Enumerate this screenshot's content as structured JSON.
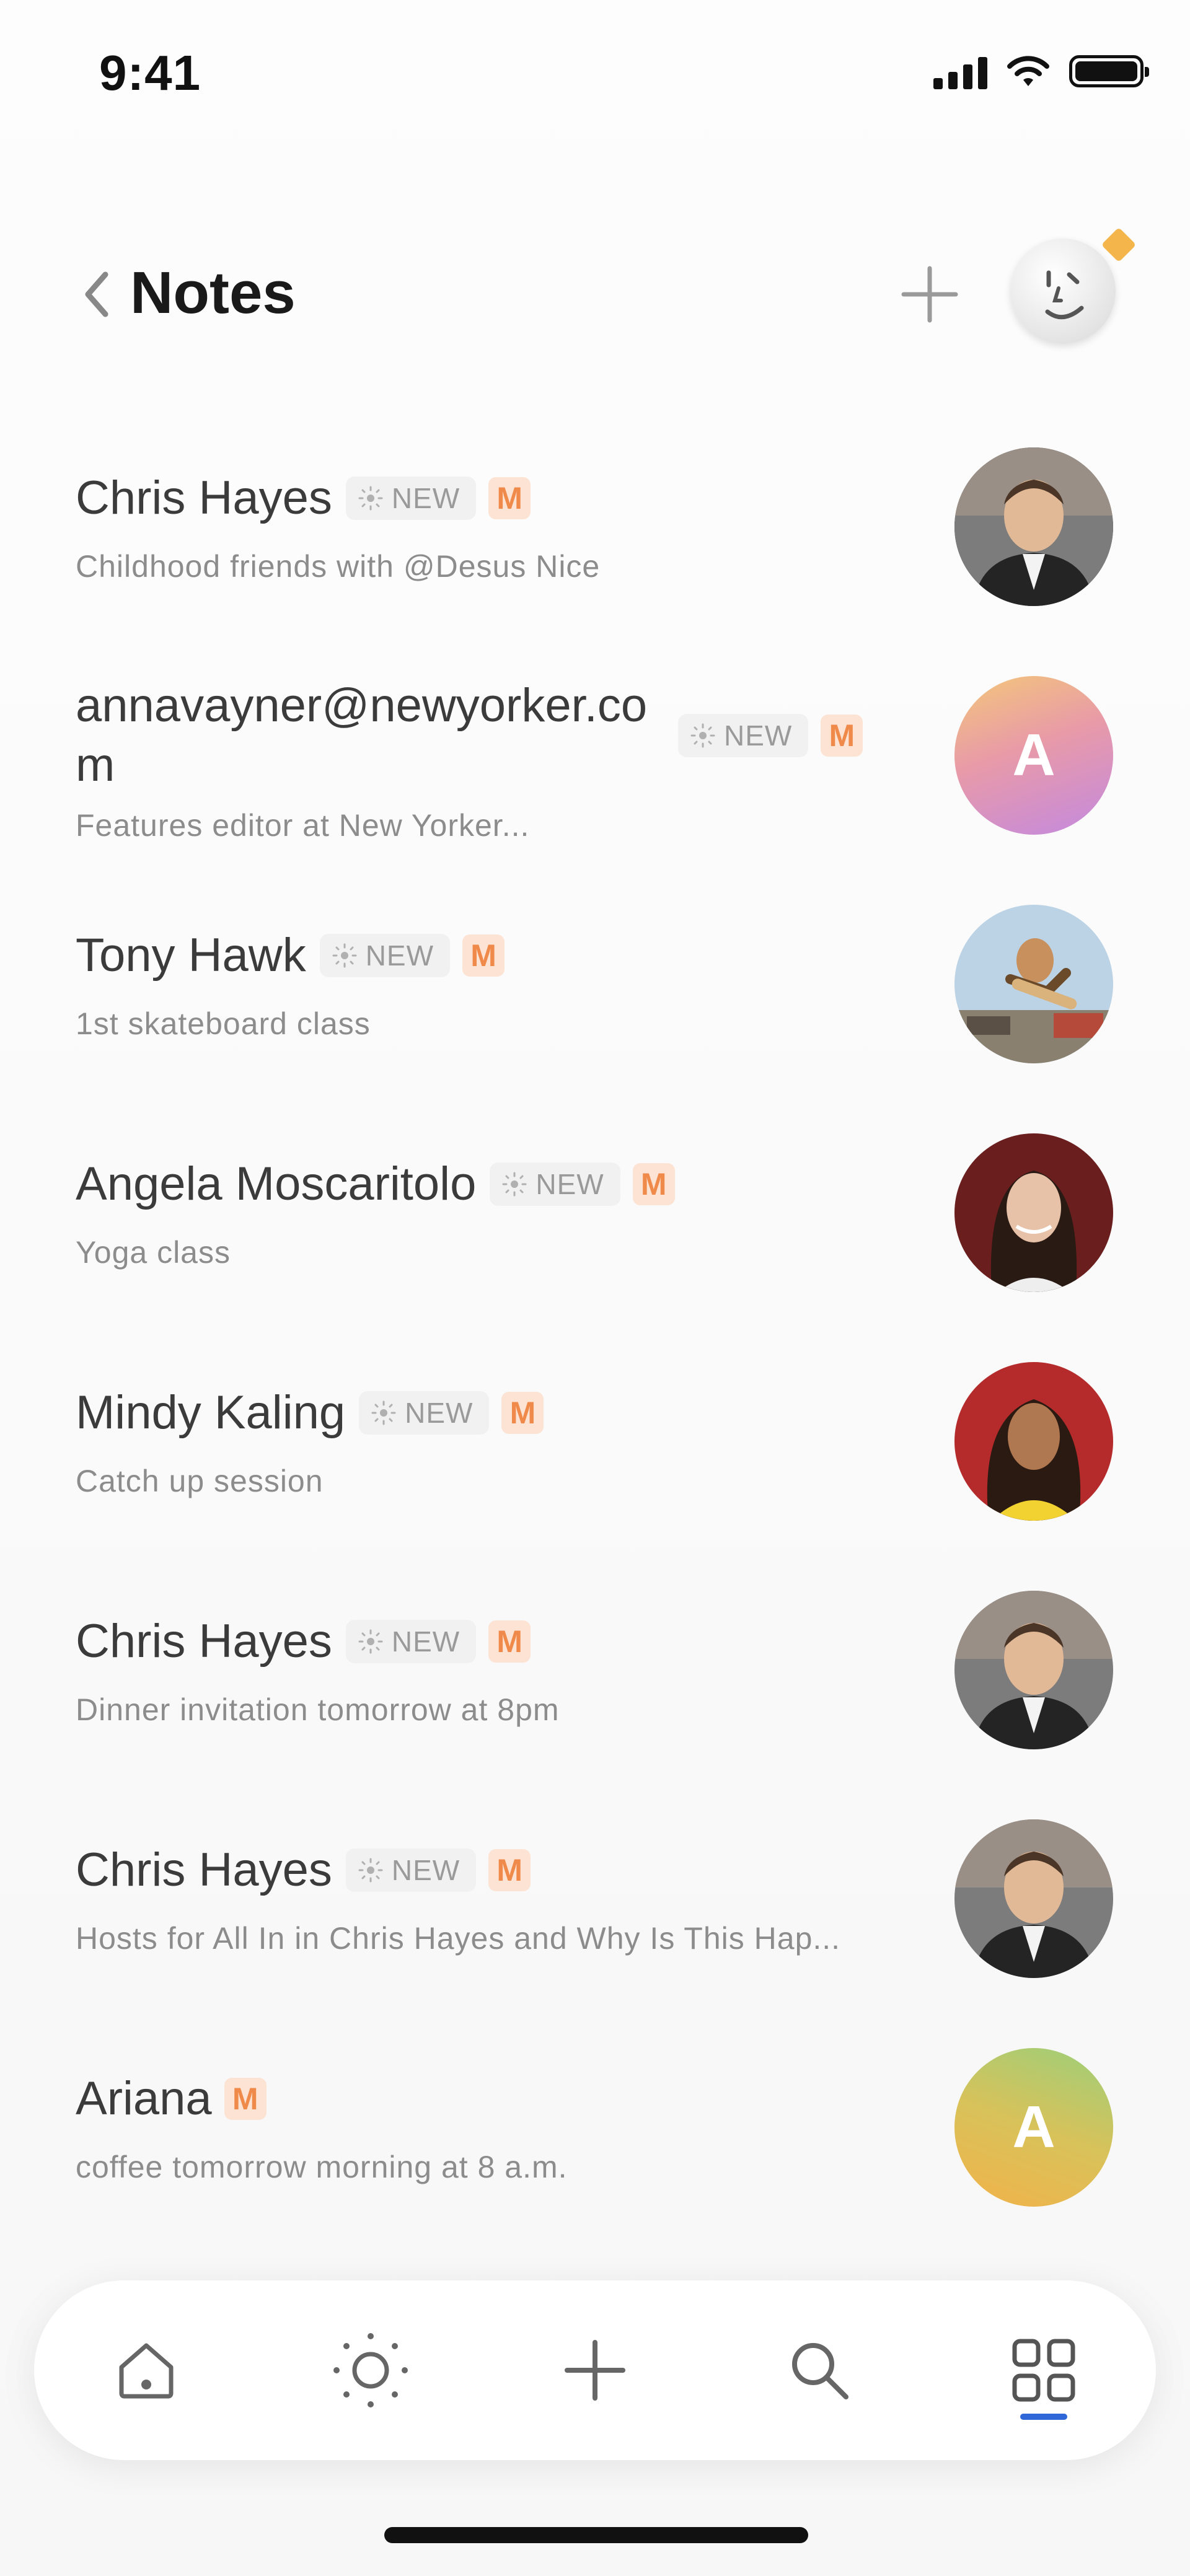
{
  "status_bar": {
    "time": "9:41"
  },
  "header": {
    "title": "Notes"
  },
  "colors": {
    "accent": "#2f67d8",
    "badge_m_bg": "#fde3d3",
    "badge_m_fg": "#f08a4b",
    "notif": "#f4b54a"
  },
  "notes": [
    {
      "name": "Chris Hayes",
      "badge_new": "NEW",
      "badge_m": "M",
      "subtitle": "Childhood friends with @Desus Nice",
      "avatar": "photo"
    },
    {
      "name": "annavayner@newyorker.com",
      "badge_new": "NEW",
      "badge_m": "M",
      "subtitle": "Features editor at New Yorker...",
      "avatar": "letter",
      "avatar_letter": "A"
    },
    {
      "name": "Tony Hawk",
      "badge_new": "NEW",
      "badge_m": "M",
      "subtitle": "1st skateboard class",
      "avatar": "photo"
    },
    {
      "name": "Angela Moscaritolo",
      "badge_new": "NEW",
      "badge_m": "M",
      "subtitle": "Yoga class",
      "avatar": "photo"
    },
    {
      "name": "Mindy Kaling",
      "badge_new": "NEW",
      "badge_m": "M",
      "subtitle": "Catch up session",
      "avatar": "photo"
    },
    {
      "name": "Chris Hayes",
      "badge_new": "NEW",
      "badge_m": "M",
      "subtitle": "Dinner invitation tomorrow at 8pm",
      "avatar": "photo"
    },
    {
      "name": "Chris Hayes",
      "badge_new": "NEW",
      "badge_m": "M",
      "subtitle": "Hosts for All In in Chris Hayes and Why Is This Hap...",
      "avatar": "photo"
    },
    {
      "name": "Ariana",
      "badge_m": "M",
      "subtitle": "coffee tomorrow morning at 8 a.m.",
      "avatar": "letter",
      "avatar_letter": "A"
    }
  ],
  "tab_bar": {
    "tabs": [
      {
        "icon": "home-icon"
      },
      {
        "icon": "sun-icon"
      },
      {
        "icon": "plus-icon"
      },
      {
        "icon": "search-icon"
      },
      {
        "icon": "grid-icon",
        "active": true
      }
    ]
  }
}
